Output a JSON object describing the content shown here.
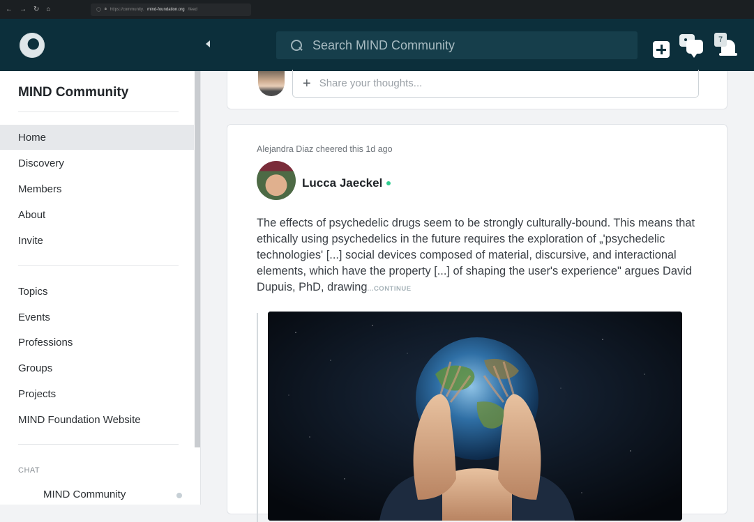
{
  "browser": {
    "url_prefix": "https://community.",
    "url_host": "mind-foundation.org",
    "url_path": "/feed"
  },
  "header": {
    "search_placeholder": "Search MIND Community",
    "notification_count": "7"
  },
  "sidebar": {
    "title": "MIND Community",
    "primary_items": [
      {
        "label": "Home",
        "active": true
      },
      {
        "label": "Discovery"
      },
      {
        "label": "Members"
      },
      {
        "label": "About"
      },
      {
        "label": "Invite"
      }
    ],
    "secondary_items": [
      {
        "label": "Topics"
      },
      {
        "label": "Events"
      },
      {
        "label": "Professions"
      },
      {
        "label": "Groups"
      },
      {
        "label": "Projects"
      },
      {
        "label": "MIND Foundation Website"
      }
    ],
    "chat_heading": "CHAT",
    "chat_items": [
      {
        "label": "MIND Community"
      }
    ]
  },
  "composer": {
    "placeholder": "Share your thoughts..."
  },
  "post": {
    "activity": "Alejandra Diaz cheered this 1d ago",
    "author": "Lucca Jaeckel",
    "text": "The effects of psychedelic drugs seem to be strongly culturally-bound.  This means that ethically using psychedelics in the future requires the exploration of „'psychedelic technologies' [...] social devices composed of material, discursive, and interactional elements, which have the property [...] of shaping the user's experience\" argues David Dupuis, PhD, drawing",
    "continue_label": "...CONTINUE"
  },
  "colors": {
    "header_bg": "#0c2f3b",
    "online": "#2ecc8f"
  }
}
